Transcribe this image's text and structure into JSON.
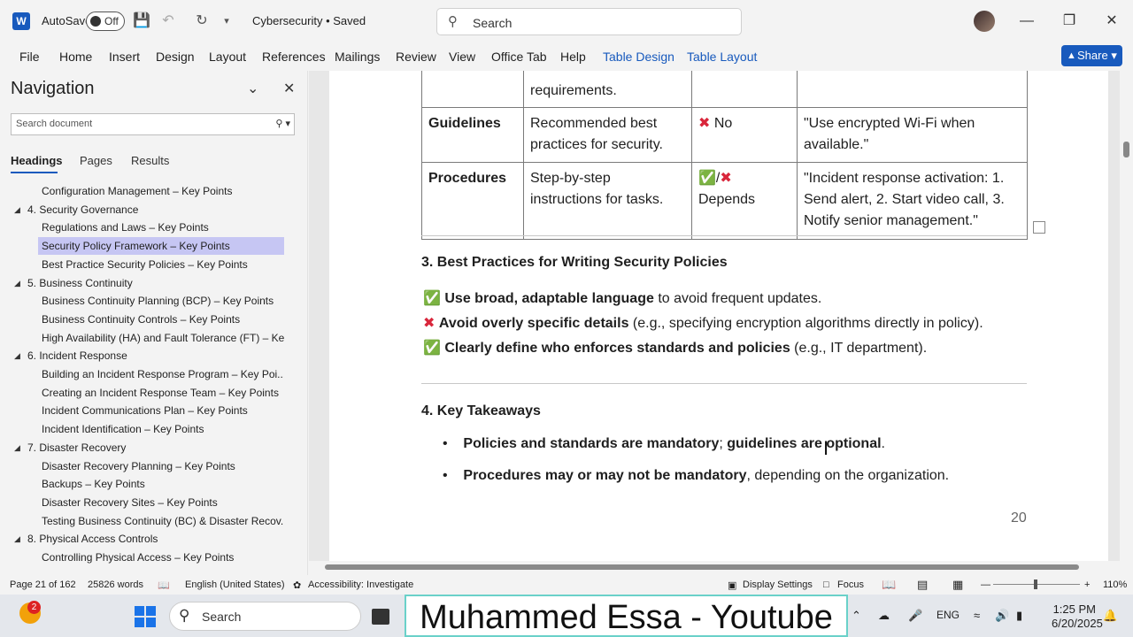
{
  "titlebar": {
    "autosave_label": "AutoSave",
    "autosave_state": "Off",
    "doc_title": "Cybersecurity • Saved",
    "search_placeholder": "Search",
    "icons": [
      "save-icon",
      "undo-icon",
      "redo-icon",
      "customize-icon"
    ]
  },
  "ribbon": {
    "tabs": [
      "File",
      "Home",
      "Insert",
      "Design",
      "Layout",
      "References",
      "Mailings",
      "Review",
      "View",
      "Office Tab",
      "Help",
      "Table Design",
      "Table Layout"
    ],
    "share_label": "Share"
  },
  "navigation": {
    "title": "Navigation",
    "search_placeholder": "Search document",
    "tabs": [
      "Headings",
      "Pages",
      "Results"
    ],
    "items": [
      {
        "label": "Configuration Management – Key Points",
        "level": 2
      },
      {
        "label": "4. Security Governance",
        "level": 1
      },
      {
        "label": "Regulations and Laws – Key Points",
        "level": 2
      },
      {
        "label": "Security Policy Framework – Key Points",
        "level": 2,
        "selected": true
      },
      {
        "label": "Best Practice Security Policies – Key Points",
        "level": 2
      },
      {
        "label": "5. Business Continuity",
        "level": 1
      },
      {
        "label": "Business Continuity Planning (BCP) – Key Points",
        "level": 2
      },
      {
        "label": "Business Continuity Controls – Key Points",
        "level": 2
      },
      {
        "label": "High Availability (HA) and Fault Tolerance (FT) – Ke...",
        "level": 2
      },
      {
        "label": "6. Incident Response",
        "level": 1
      },
      {
        "label": "Building an Incident Response Program – Key Poi...",
        "level": 2
      },
      {
        "label": "Creating an Incident Response Team – Key Points",
        "level": 2
      },
      {
        "label": "Incident Communications Plan – Key Points",
        "level": 2
      },
      {
        "label": "Incident Identification – Key Points",
        "level": 2
      },
      {
        "label": "7. Disaster Recovery",
        "level": 1
      },
      {
        "label": "Disaster Recovery Planning – Key Points",
        "level": 2
      },
      {
        "label": "Backups – Key Points",
        "level": 2
      },
      {
        "label": "Disaster Recovery Sites – Key Points",
        "level": 2
      },
      {
        "label": "Testing Business Continuity (BC) & Disaster Recov...",
        "level": 2
      },
      {
        "label": "8. Physical Access Controls",
        "level": 1
      },
      {
        "label": "Controlling Physical Access – Key Points",
        "level": 2
      }
    ]
  },
  "document": {
    "table": {
      "top_row": {
        "desc": "requirements."
      },
      "rows": [
        {
          "name": "Guidelines",
          "desc": "Recommended best practices for security.",
          "mandatory": "No",
          "example": "\"Use encrypted Wi-Fi when available.\""
        },
        {
          "name": "Procedures",
          "desc": "Step-by-step instructions for tasks.",
          "mandatory": "Depends",
          "example": "\"Incident response activation: 1. Send alert, 2. Start video call, 3. Notify senior management.\""
        }
      ]
    },
    "section3": {
      "heading": "3. Best Practices for Writing Security Policies",
      "lines": [
        {
          "mark": "ok",
          "bold": "Use broad, adaptable language",
          "rest": " to avoid frequent updates."
        },
        {
          "mark": "x",
          "bold": "Avoid overly specific details",
          "rest": " (e.g., specifying encryption algorithms directly in policy)."
        },
        {
          "mark": "ok",
          "bold": "Clearly define who enforces standards and policies",
          "rest": " (e.g., IT department)."
        }
      ]
    },
    "section4": {
      "heading": "4. Key Takeaways",
      "bullets": [
        {
          "bold": "Policies and standards are mandatory",
          "mid": "; ",
          "bold2": "guidelines are optional",
          "rest": "."
        },
        {
          "bold": "Procedures may or may not be mandatory",
          "mid": "",
          "bold2": "",
          "rest": ", depending on the organization."
        }
      ]
    },
    "page_number": "20"
  },
  "statusbar": {
    "page": "Page 21 of 162",
    "words": "25826 words",
    "language": "English (United States)",
    "accessibility": "Accessibility: Investigate",
    "display_settings": "Display Settings",
    "focus": "Focus",
    "zoom": "110%"
  },
  "taskbar": {
    "notification_count": "2",
    "search_placeholder": "Search",
    "banner": "Muhammed Essa - Youtube",
    "lang": "ENG",
    "time": "1:25 PM",
    "date": "6/20/2025"
  },
  "colors": {
    "accent": "#185abd",
    "check": "#39b54a",
    "cross": "#d9263b",
    "nav_selected": "#c6c6f3"
  }
}
